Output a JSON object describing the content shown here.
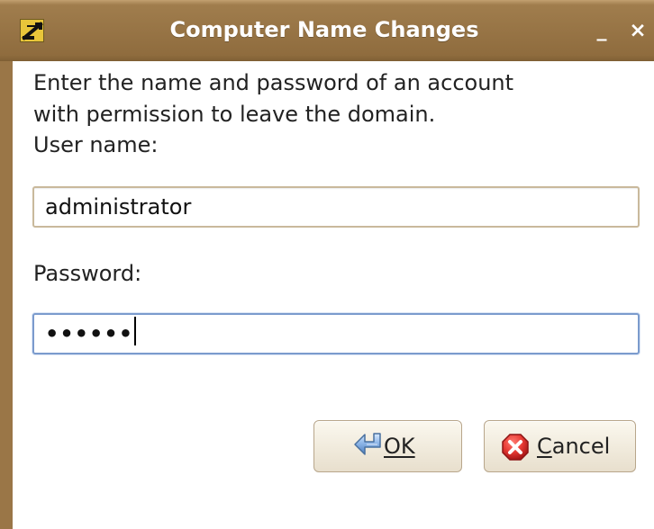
{
  "window": {
    "title": "Computer Name Changes",
    "minimize_glyph": "_",
    "close_glyph": "×",
    "icon": "app-icon"
  },
  "dialog": {
    "instruction_line1": "Enter the name and password of an account",
    "instruction_line2": "with permission to leave the domain.",
    "username_label": "User name:",
    "username_value": "administrator",
    "password_label": "Password:",
    "password_value": "••••••",
    "ok_label": "OK",
    "cancel_label_first": "C",
    "cancel_label_rest": "ancel"
  },
  "icons": {
    "ok": "enter-arrow-icon",
    "cancel": "cancel-x-icon"
  },
  "colors": {
    "titlebar": "#9a7647",
    "focus_border": "#7b9bcd",
    "field_border": "#c9b99c",
    "cancel_red": "#d62a2a"
  }
}
